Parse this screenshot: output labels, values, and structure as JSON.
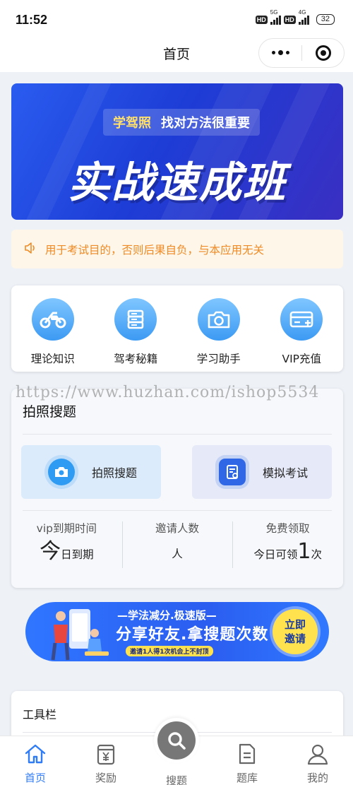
{
  "status_bar": {
    "time": "11:52",
    "hd1": "HD",
    "net1": "5G",
    "hd2": "HD",
    "net2": "4G",
    "battery": "32"
  },
  "nav": {
    "title": "首页"
  },
  "banner": {
    "pill_highlight": "学驾照",
    "pill_text": "找对方法很重要",
    "headline": "实战速成班"
  },
  "notice": {
    "text": "用于考试目的，否则后果自负，与本应用无关"
  },
  "features": [
    {
      "label": "理论知识",
      "icon": "motorcycle-icon"
    },
    {
      "label": "驾考秘籍",
      "icon": "books-icon"
    },
    {
      "label": "学习助手",
      "icon": "camera-icon"
    },
    {
      "label": "VIP充值",
      "icon": "card-icon"
    }
  ],
  "watermark": "https://www.huzhan.com/ishop5534",
  "search_card": {
    "title": "拍照搜题",
    "photo_search_label": "拍照搜题",
    "mock_exam_label": "模拟考试",
    "stats": [
      {
        "label": "vip到期时间",
        "value_big": "今",
        "value_small": "日到期"
      },
      {
        "label": "邀请人数",
        "value_small": "人"
      },
      {
        "label": "免费领取",
        "value_prefix": "今日可领",
        "value_big": "1",
        "value_suffix": "次"
      }
    ]
  },
  "promo": {
    "top_text": "—学法减分.极速版—",
    "main_text": "分享好友.拿搜题次数",
    "sub_text": "邀请1人得1次机会上不封顶",
    "cta_line1": "立即",
    "cta_line2": "邀请"
  },
  "tools": {
    "title": "工具栏"
  },
  "tabbar": [
    {
      "label": "首页",
      "icon": "home-icon",
      "active": true
    },
    {
      "label": "奖励",
      "icon": "reward-icon"
    },
    {
      "label": "搜题",
      "icon": "search-icon"
    },
    {
      "label": "题库",
      "icon": "document-icon"
    },
    {
      "label": "我的",
      "icon": "user-icon"
    }
  ],
  "colors": {
    "accent": "#2f7cf6",
    "notice_text": "#f08a24",
    "promo_yellow": "#ffe24d"
  }
}
